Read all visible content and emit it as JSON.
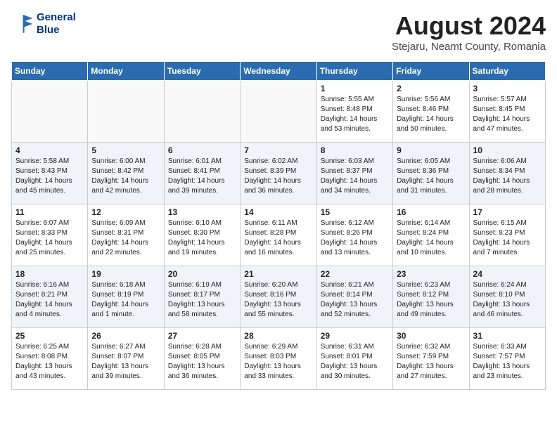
{
  "header": {
    "logo_line1": "General",
    "logo_line2": "Blue",
    "month_year": "August 2024",
    "location": "Stejaru, Neamt County, Romania"
  },
  "weekdays": [
    "Sunday",
    "Monday",
    "Tuesday",
    "Wednesday",
    "Thursday",
    "Friday",
    "Saturday"
  ],
  "weeks": [
    [
      {
        "day": "",
        "content": ""
      },
      {
        "day": "",
        "content": ""
      },
      {
        "day": "",
        "content": ""
      },
      {
        "day": "",
        "content": ""
      },
      {
        "day": "1",
        "content": "Sunrise: 5:55 AM\nSunset: 8:48 PM\nDaylight: 14 hours\nand 53 minutes."
      },
      {
        "day": "2",
        "content": "Sunrise: 5:56 AM\nSunset: 8:46 PM\nDaylight: 14 hours\nand 50 minutes."
      },
      {
        "day": "3",
        "content": "Sunrise: 5:57 AM\nSunset: 8:45 PM\nDaylight: 14 hours\nand 47 minutes."
      }
    ],
    [
      {
        "day": "4",
        "content": "Sunrise: 5:58 AM\nSunset: 8:43 PM\nDaylight: 14 hours\nand 45 minutes."
      },
      {
        "day": "5",
        "content": "Sunrise: 6:00 AM\nSunset: 8:42 PM\nDaylight: 14 hours\nand 42 minutes."
      },
      {
        "day": "6",
        "content": "Sunrise: 6:01 AM\nSunset: 8:41 PM\nDaylight: 14 hours\nand 39 minutes."
      },
      {
        "day": "7",
        "content": "Sunrise: 6:02 AM\nSunset: 8:39 PM\nDaylight: 14 hours\nand 36 minutes."
      },
      {
        "day": "8",
        "content": "Sunrise: 6:03 AM\nSunset: 8:37 PM\nDaylight: 14 hours\nand 34 minutes."
      },
      {
        "day": "9",
        "content": "Sunrise: 6:05 AM\nSunset: 8:36 PM\nDaylight: 14 hours\nand 31 minutes."
      },
      {
        "day": "10",
        "content": "Sunrise: 6:06 AM\nSunset: 8:34 PM\nDaylight: 14 hours\nand 28 minutes."
      }
    ],
    [
      {
        "day": "11",
        "content": "Sunrise: 6:07 AM\nSunset: 8:33 PM\nDaylight: 14 hours\nand 25 minutes."
      },
      {
        "day": "12",
        "content": "Sunrise: 6:09 AM\nSunset: 8:31 PM\nDaylight: 14 hours\nand 22 minutes."
      },
      {
        "day": "13",
        "content": "Sunrise: 6:10 AM\nSunset: 8:30 PM\nDaylight: 14 hours\nand 19 minutes."
      },
      {
        "day": "14",
        "content": "Sunrise: 6:11 AM\nSunset: 8:28 PM\nDaylight: 14 hours\nand 16 minutes."
      },
      {
        "day": "15",
        "content": "Sunrise: 6:12 AM\nSunset: 8:26 PM\nDaylight: 14 hours\nand 13 minutes."
      },
      {
        "day": "16",
        "content": "Sunrise: 6:14 AM\nSunset: 8:24 PM\nDaylight: 14 hours\nand 10 minutes."
      },
      {
        "day": "17",
        "content": "Sunrise: 6:15 AM\nSunset: 8:23 PM\nDaylight: 14 hours\nand 7 minutes."
      }
    ],
    [
      {
        "day": "18",
        "content": "Sunrise: 6:16 AM\nSunset: 8:21 PM\nDaylight: 14 hours\nand 4 minutes."
      },
      {
        "day": "19",
        "content": "Sunrise: 6:18 AM\nSunset: 8:19 PM\nDaylight: 14 hours\nand 1 minute."
      },
      {
        "day": "20",
        "content": "Sunrise: 6:19 AM\nSunset: 8:17 PM\nDaylight: 13 hours\nand 58 minutes."
      },
      {
        "day": "21",
        "content": "Sunrise: 6:20 AM\nSunset: 8:16 PM\nDaylight: 13 hours\nand 55 minutes."
      },
      {
        "day": "22",
        "content": "Sunrise: 6:21 AM\nSunset: 8:14 PM\nDaylight: 13 hours\nand 52 minutes."
      },
      {
        "day": "23",
        "content": "Sunrise: 6:23 AM\nSunset: 8:12 PM\nDaylight: 13 hours\nand 49 minutes."
      },
      {
        "day": "24",
        "content": "Sunrise: 6:24 AM\nSunset: 8:10 PM\nDaylight: 13 hours\nand 46 minutes."
      }
    ],
    [
      {
        "day": "25",
        "content": "Sunrise: 6:25 AM\nSunset: 8:08 PM\nDaylight: 13 hours\nand 43 minutes."
      },
      {
        "day": "26",
        "content": "Sunrise: 6:27 AM\nSunset: 8:07 PM\nDaylight: 13 hours\nand 39 minutes."
      },
      {
        "day": "27",
        "content": "Sunrise: 6:28 AM\nSunset: 8:05 PM\nDaylight: 13 hours\nand 36 minutes."
      },
      {
        "day": "28",
        "content": "Sunrise: 6:29 AM\nSunset: 8:03 PM\nDaylight: 13 hours\nand 33 minutes."
      },
      {
        "day": "29",
        "content": "Sunrise: 6:31 AM\nSunset: 8:01 PM\nDaylight: 13 hours\nand 30 minutes."
      },
      {
        "day": "30",
        "content": "Sunrise: 6:32 AM\nSunset: 7:59 PM\nDaylight: 13 hours\nand 27 minutes."
      },
      {
        "day": "31",
        "content": "Sunrise: 6:33 AM\nSunset: 7:57 PM\nDaylight: 13 hours\nand 23 minutes."
      }
    ]
  ]
}
